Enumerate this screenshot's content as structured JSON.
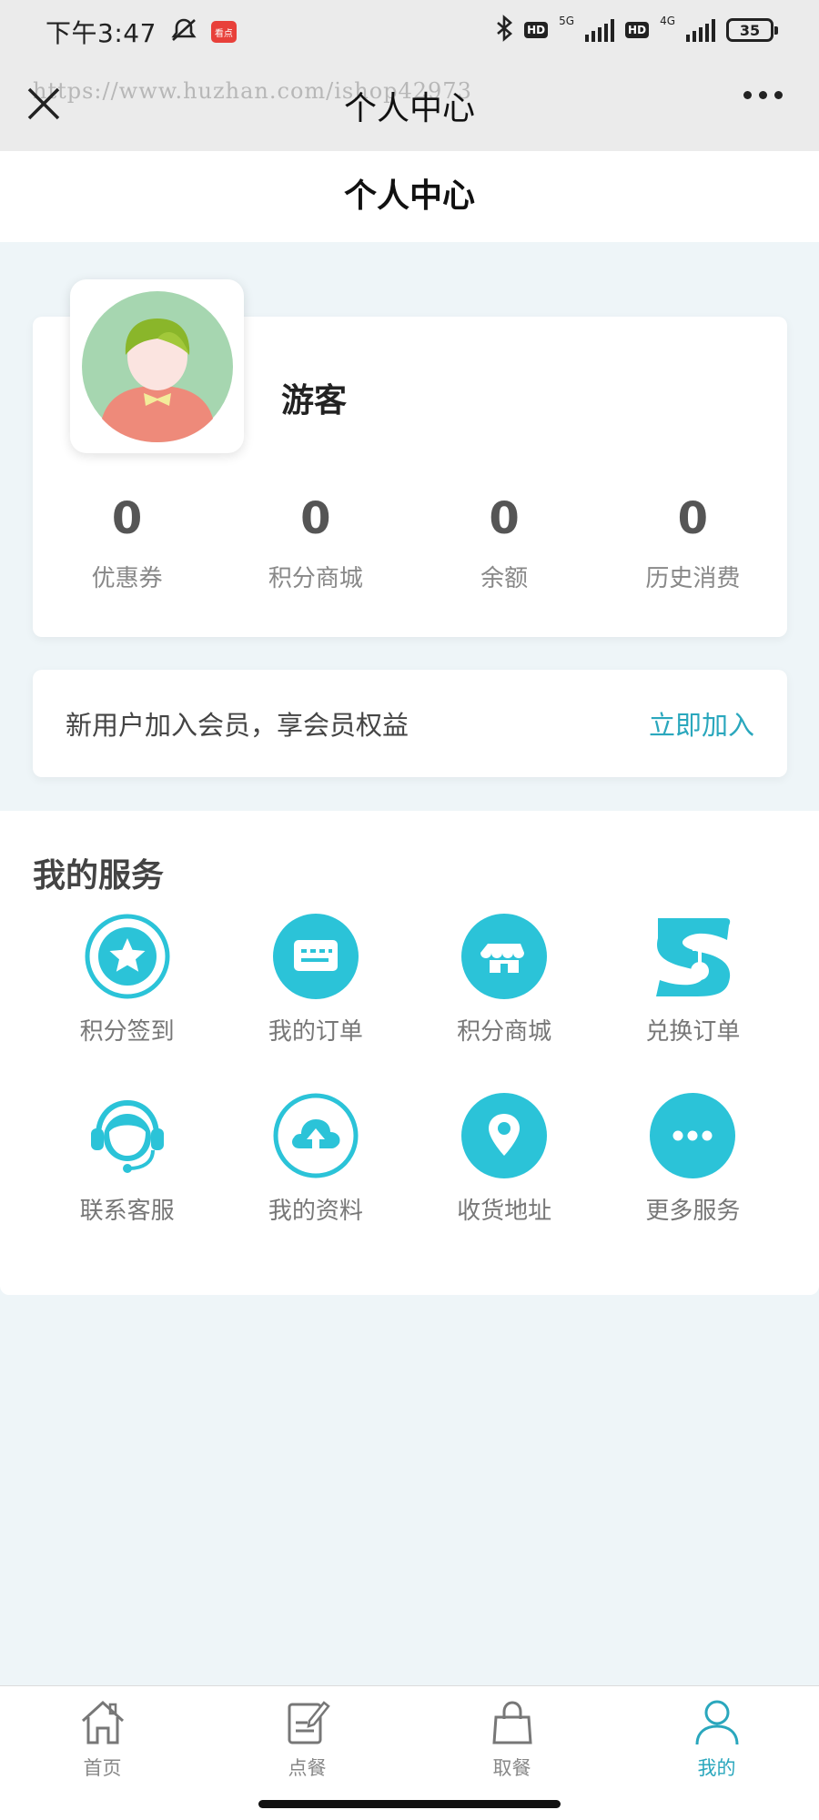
{
  "status_bar": {
    "time": "下午3:47",
    "app_badge": "看点",
    "net1": "5G",
    "net2": "4G",
    "hd": "HD",
    "battery": "35"
  },
  "navbar": {
    "title": "个人中心",
    "watermark": "https://www.huzhan.com/ishop42973"
  },
  "page": {
    "header": "个人中心"
  },
  "profile": {
    "username": "游客",
    "stats": [
      {
        "value": "0",
        "label": "优惠券"
      },
      {
        "value": "0",
        "label": "积分商城"
      },
      {
        "value": "0",
        "label": "余额"
      },
      {
        "value": "0",
        "label": "历史消费"
      }
    ]
  },
  "member": {
    "text": "新用户加入会员，享会员权益",
    "action": "立即加入"
  },
  "services": {
    "title": "我的服务",
    "items": [
      {
        "label": "积分签到",
        "icon": "star-icon"
      },
      {
        "label": "我的订单",
        "icon": "order-icon"
      },
      {
        "label": "积分商城",
        "icon": "shop-icon"
      },
      {
        "label": "兑换订单",
        "icon": "exchange-icon"
      },
      {
        "label": "联系客服",
        "icon": "headset-icon"
      },
      {
        "label": "我的资料",
        "icon": "cloud-upload-icon"
      },
      {
        "label": "收货地址",
        "icon": "location-icon"
      },
      {
        "label": "更多服务",
        "icon": "more-icon"
      }
    ]
  },
  "tabbar": {
    "items": [
      {
        "label": "首页",
        "icon": "home-icon"
      },
      {
        "label": "点餐",
        "icon": "order-food-icon"
      },
      {
        "label": "取餐",
        "icon": "bag-icon"
      },
      {
        "label": "我的",
        "icon": "user-icon",
        "active": true
      }
    ]
  },
  "colors": {
    "accent": "#2aa7bd",
    "icon": "#2bc3d8",
    "page_bg": "#eef5f8"
  }
}
